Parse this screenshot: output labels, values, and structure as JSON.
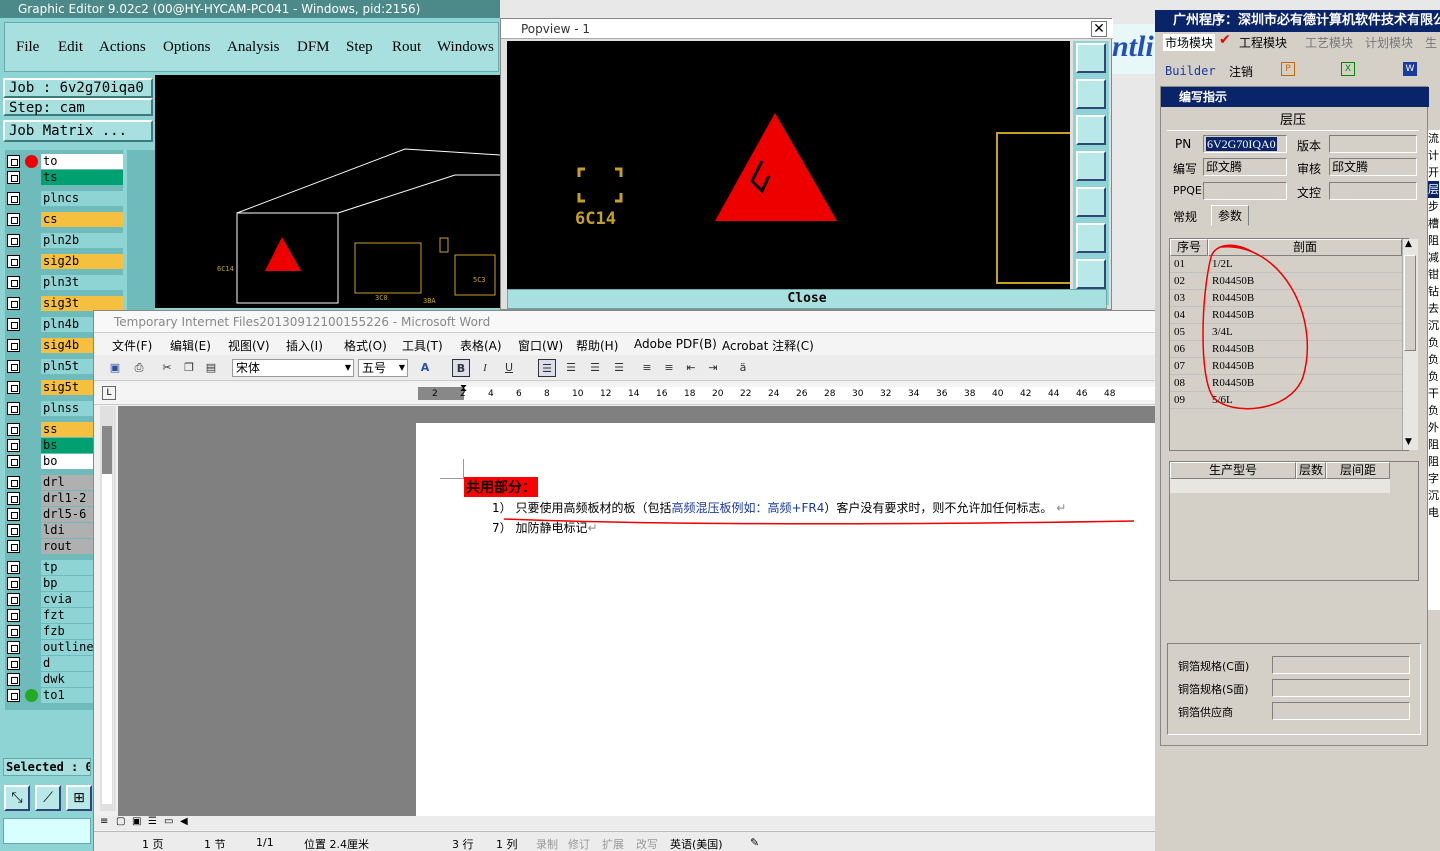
{
  "graphic_editor": {
    "title": "Graphic Editor 9.02c2 (00@HY-HYCAM-PC041 - Windows, pid:2156)",
    "menu": [
      "File",
      "Edit",
      "Actions",
      "Options",
      "Analysis",
      "DFM",
      "Step",
      "Rout",
      "Windows"
    ],
    "job_label": "Job : 6v2g70iqa0",
    "step_label": "Step: cam",
    "job_matrix": "Job Matrix ...",
    "logo_fragment": "ntli",
    "layers": [
      {
        "name": "to",
        "color": "#ffffff"
      },
      {
        "name": "ts",
        "color": "#00a070"
      },
      {
        "name": "plncs",
        "color": "#8fd4d4"
      },
      {
        "name": "cs",
        "color": "#f5c040"
      },
      {
        "name": "pln2b",
        "color": "#8fd4d4"
      },
      {
        "name": "sig2b",
        "color": "#f5c040"
      },
      {
        "name": "pln3t",
        "color": "#8fd4d4"
      },
      {
        "name": "sig3t",
        "color": "#f5c040"
      },
      {
        "name": "pln4b",
        "color": "#8fd4d4"
      },
      {
        "name": "sig4b",
        "color": "#f5c040"
      },
      {
        "name": "pln5t",
        "color": "#8fd4d4"
      },
      {
        "name": "sig5t",
        "color": "#f5c040"
      },
      {
        "name": "plnss",
        "color": "#8fd4d4"
      },
      {
        "name": "ss",
        "color": "#f5c040"
      },
      {
        "name": "bs",
        "color": "#00a070"
      },
      {
        "name": "bo",
        "color": "#ffffff"
      },
      {
        "name": "drl",
        "color": "#b0b0b0"
      },
      {
        "name": "drl1-2",
        "color": "#b0b0b0"
      },
      {
        "name": "drl5-6",
        "color": "#b0b0b0"
      },
      {
        "name": "ldi",
        "color": "#b0b0b0"
      },
      {
        "name": "rout",
        "color": "#b0b0b0"
      },
      {
        "name": "tp",
        "color": "#8fd4d4"
      },
      {
        "name": "bp",
        "color": "#8fd4d4"
      },
      {
        "name": "cvia",
        "color": "#8fd4d4"
      },
      {
        "name": "fzt",
        "color": "#8fd4d4"
      },
      {
        "name": "fzb",
        "color": "#8fd4d4"
      },
      {
        "name": "outline",
        "color": "#8fd4d4"
      },
      {
        "name": "d",
        "color": "#8fd4d4"
      },
      {
        "name": "dwk",
        "color": "#8fd4d4"
      },
      {
        "name": "to1",
        "color": "#8fd4d4"
      }
    ],
    "selected": "Selected : 0",
    "canvas_labels": [
      "6C14",
      "3C11",
      "5C3",
      "3C0",
      "3BA"
    ]
  },
  "popview": {
    "title": "Popview - 1",
    "label": "6C14",
    "close": "Close"
  },
  "word": {
    "title": "Temporary Internet Files20130912100155226 - Microsoft Word",
    "menu": [
      "文件(F)",
      "编辑(E)",
      "视图(V)",
      "插入(I)",
      "格式(O)",
      "工具(T)",
      "表格(A)",
      "窗口(W)",
      "帮助(H)",
      "Adobe PDF(B)",
      "Acrobat 注释(C)"
    ],
    "font_name": "宋体",
    "font_size": "五号",
    "ruler_numbers": [
      "2",
      "2",
      "4",
      "6",
      "8",
      "10",
      "12",
      "14",
      "16",
      "18",
      "20",
      "22",
      "24",
      "26",
      "28",
      "30",
      "32",
      "34",
      "36",
      "38",
      "40",
      "42",
      "44",
      "46",
      "48"
    ],
    "heading": "共用部分：",
    "line1_a": "1） 只要使用高频板材的板（包括",
    "line1_b": "高频混压板例如：高频+FR4",
    "line1_c": "）客户没有要求时，则不允许加任何标志。",
    "line2": "7） 加防静电标记",
    "status": {
      "page": "1 页",
      "section": "1 节",
      "pages": "1/1",
      "position": "位置 2.4厘米",
      "line": "3 行",
      "col": "1 列",
      "rec": "录制",
      "trk": "修订",
      "ext": "扩展",
      "ovr": "改写",
      "lang": "英语(美国)"
    }
  },
  "right_app": {
    "title": "广州程序：深圳市必有德计算机软件技术有限公",
    "tabs": [
      "市场模块",
      "工程模块",
      "工艺模块",
      "计划模块",
      "生"
    ],
    "builder": "Builder",
    "logout": "注销",
    "dialog_title": "编写指示",
    "section": "层压",
    "pn_label": "PN",
    "pn_value": "6V2G70IQA0",
    "version_label": "版本",
    "writer_label": "编写",
    "writer_value": "邱文腾",
    "reviewer_label": "审核",
    "reviewer_value": "邱文腾",
    "ppqe_label": "PPQE",
    "doc_label": "文控",
    "subtabs": [
      "常规",
      "参数"
    ],
    "grid_headers": [
      "序号",
      "剖面"
    ],
    "rows": [
      {
        "no": "01",
        "val": "1/2L"
      },
      {
        "no": "02",
        "val": "R04450B"
      },
      {
        "no": "03",
        "val": "R04450B"
      },
      {
        "no": "04",
        "val": "R04450B"
      },
      {
        "no": "05",
        "val": "3/4L"
      },
      {
        "no": "06",
        "val": "R04450B"
      },
      {
        "no": "07",
        "val": "R04450B"
      },
      {
        "no": "08",
        "val": "R04450B"
      },
      {
        "no": "09",
        "val": "5/6L"
      }
    ],
    "grid2_headers": [
      "生产型号",
      "层数",
      "层间距"
    ],
    "foil_c": "铜箔规格(C面)",
    "foil_s": "铜箔规格(S面)",
    "foil_supplier": "铜箔供应商",
    "strip_chars": [
      "流",
      "计",
      "开",
      "层",
      "步",
      "槽",
      "阻",
      "减",
      "钳",
      "钻",
      "去",
      "沉",
      "负",
      "负",
      "负",
      "干",
      "负",
      "外",
      "阻",
      "阻",
      "字",
      "沉",
      "电"
    ]
  }
}
